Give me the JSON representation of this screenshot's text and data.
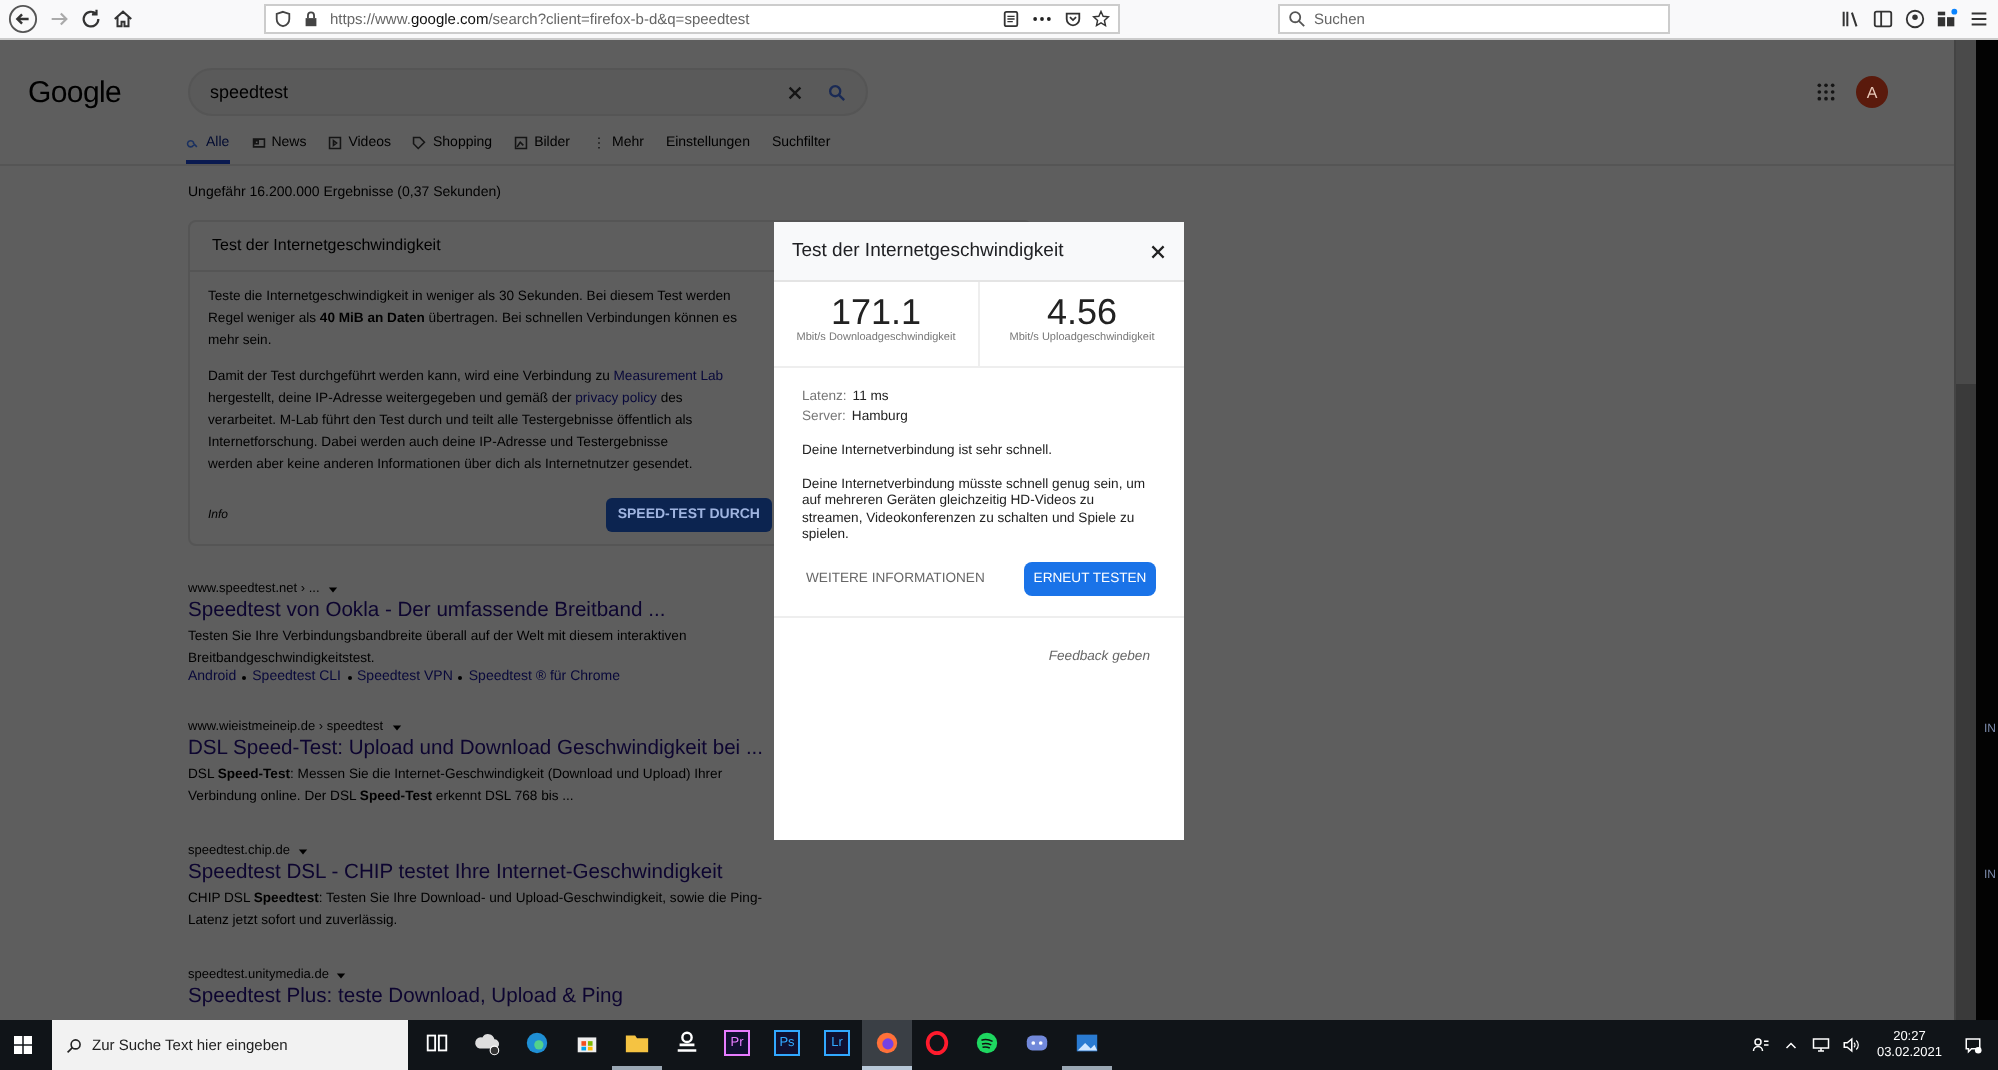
{
  "browser": {
    "url_prefix": "https://www.",
    "url_domain": "google.com",
    "url_rest": "/search?client=firefox-b-d&q=speedtest",
    "search_placeholder": "Suchen"
  },
  "google": {
    "logo": "Google",
    "query": "speedtest",
    "avatar": "A",
    "tabs": [
      {
        "label": "Alle",
        "kind": "search",
        "selected": true
      },
      {
        "label": "News",
        "kind": "news",
        "selected": false
      },
      {
        "label": "Videos",
        "kind": "video",
        "selected": false
      },
      {
        "label": "Shopping",
        "kind": "tag",
        "selected": false
      },
      {
        "label": "Bilder",
        "kind": "image",
        "selected": false
      },
      {
        "label": "Mehr",
        "kind": "more",
        "selected": false
      },
      {
        "label": "Einstellungen",
        "kind": "plain",
        "selected": false
      },
      {
        "label": "Suchfilter",
        "kind": "plain",
        "selected": false
      }
    ],
    "result_stats": "Ungefähr 16.200.000 Ergebnisse (0,37 Sekunden)",
    "speed_card": {
      "title": "Test der Internetgeschwindigkeit",
      "paragraphs": [
        [
          [
            {
              "kind": "plain",
              "text": "Teste die Internetgeschwindigkeit in weniger als 30 Sekunden. Bei diesem Test werden"
            }
          ],
          [
            {
              "kind": "plain",
              "text": "Regel weniger als "
            },
            {
              "kind": "bold",
              "text": "40 MiB an Daten"
            },
            {
              "kind": "plain",
              "text": " übertragen. Bei schnellen Verbindungen können es"
            }
          ],
          [
            {
              "kind": "plain",
              "text": "mehr sein."
            }
          ]
        ],
        [
          [
            {
              "kind": "plain",
              "text": "Damit der Test durchgeführt werden kann, wird eine Verbindung zu "
            },
            {
              "kind": "link",
              "text": "Measurement Lab"
            }
          ],
          [
            {
              "kind": "plain",
              "text": "hergestellt, deine IP-Adresse weitergegeben und gemäß der "
            },
            {
              "kind": "link",
              "text": "privacy policy"
            },
            {
              "kind": "plain",
              "text": " des"
            }
          ],
          [
            {
              "kind": "plain",
              "text": "verarbeitet. M-Lab führt den Test durch und teilt alle Testergebnisse öffentlich als"
            }
          ],
          [
            {
              "kind": "plain",
              "text": "Internetforschung. Dabei werden auch deine IP-Adresse und Testergebnisse"
            }
          ],
          [
            {
              "kind": "plain",
              "text": "werden aber keine anderen Informationen über dich als Internetnutzer gesendet."
            }
          ]
        ]
      ],
      "info": "Info",
      "button": "SPEED-TEST DURCH"
    },
    "results": [
      {
        "url": "www.speedtest.net › ...",
        "title": "Speedtest von Ookla - Der umfassende Breitband ...",
        "snippet": [
          "Testen Sie Ihre Verbindungsbandbreite überall auf der Welt mit diesem interaktiven",
          "Breitbandgeschwindigkeitstest."
        ],
        "links": [
          "Android",
          "Speedtest CLI",
          "Speedtest VPN",
          "Speedtest ® für Chrome"
        ]
      },
      {
        "url": "www.wieistmeineip.de › speedtest",
        "title": "DSL Speed-Test: Upload und Download Geschwindigkeit bei ...",
        "snippet": [
          "DSL **Speed-Test**: Messen Sie die Internet-Geschwindigkeit (Download und Upload) Ihrer",
          "Verbindung online. Der DSL **Speed-Test** erkennt DSL 768 bis ..."
        ]
      },
      {
        "url": "speedtest.chip.de",
        "title": "Speedtest DSL - CHIP testet Ihre Internet-Geschwindigkeit",
        "snippet": [
          "CHIP DSL **Speedtest**: Testen Sie Ihre Download- und Upload-Geschwindigkeit, sowie die Ping-",
          "Latenz jetzt sofort und zuverlässig."
        ]
      },
      {
        "url": "speedtest.unitymedia.de",
        "title": "Speedtest Plus: teste Download, Upload & Ping"
      }
    ]
  },
  "dialog": {
    "title": "Test der Internetgeschwindigkeit",
    "download_value": "171.1",
    "download_label": "Mbit/s Downloadgeschwindigkeit",
    "upload_value": "4.56",
    "upload_label": "Mbit/s Uploadgeschwindigkeit",
    "latency_label": "Latenz:",
    "latency_value": "11 ms",
    "server_label": "Server:",
    "server_value": "Hamburg",
    "verdict": "Deine Internetverbindung ist sehr schnell.",
    "description": "Deine Internetverbindung müsste schnell genug sein, um auf mehreren Geräten gleichzeitig HD-Videos zu streamen, Videokonferenzen zu schalten und Spiele zu spielen.",
    "more_button": "WEITERE INFORMATIONEN",
    "retest_button": "ERNEUT TESTEN",
    "feedback": "Feedback geben"
  },
  "edge_texts": [
    "IN",
    "IN"
  ],
  "taskbar": {
    "search_placeholder": "Zur Suche Text hier eingeben",
    "apps": [
      {
        "kind": "taskview",
        "running": false,
        "selected": false
      },
      {
        "kind": "cloud",
        "running": false,
        "selected": false
      },
      {
        "kind": "edge",
        "running": false,
        "selected": false
      },
      {
        "kind": "store",
        "running": false,
        "selected": false
      },
      {
        "kind": "folder",
        "running": true,
        "selected": false
      },
      {
        "kind": "tool",
        "running": false,
        "selected": false
      },
      {
        "kind": "label",
        "label": "Pr",
        "color": "#e77cff",
        "running": false,
        "selected": false
      },
      {
        "kind": "label",
        "label": "Ps",
        "color": "#31a8ff",
        "running": false,
        "selected": false
      },
      {
        "kind": "label",
        "label": "Lr",
        "color": "#31a8ff",
        "running": false,
        "selected": false
      },
      {
        "kind": "firefox",
        "running": true,
        "selected": true
      },
      {
        "kind": "opera",
        "running": false,
        "selected": false
      },
      {
        "kind": "spotify",
        "running": false,
        "selected": false
      },
      {
        "kind": "chat",
        "running": false,
        "selected": false
      },
      {
        "kind": "photos",
        "running": true,
        "selected": false
      }
    ],
    "time": "20:27",
    "date": "03.02.2021"
  }
}
